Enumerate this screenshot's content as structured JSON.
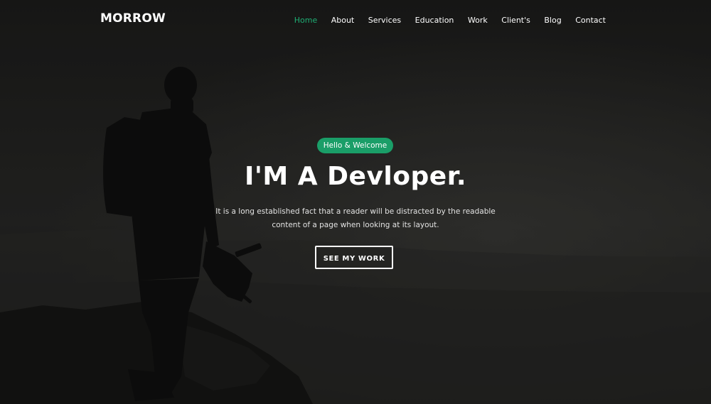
{
  "brand": {
    "logo_text": "MORROW"
  },
  "nav": {
    "items": [
      {
        "label": "Home",
        "active": true
      },
      {
        "label": "About",
        "active": false
      },
      {
        "label": "Services",
        "active": false
      },
      {
        "label": "Education",
        "active": false
      },
      {
        "label": "Work",
        "active": false
      },
      {
        "label": "Client's",
        "active": false
      },
      {
        "label": "Blog",
        "active": false
      },
      {
        "label": "Contact",
        "active": false
      }
    ]
  },
  "hero": {
    "badge": "Hello & Welcome",
    "headline": "I'M A Devloper.",
    "lead": "It is a long established fact that a reader will be distracted by the readable content of a page when looking at its layout.",
    "cta_label": "SEE MY WORK",
    "background_image": "photographer-silhouette-on-cliff"
  },
  "colors": {
    "accent": "#1a9e68",
    "nav_active": "#1fae74",
    "text": "#ffffff",
    "background": "#1c1c1b"
  }
}
